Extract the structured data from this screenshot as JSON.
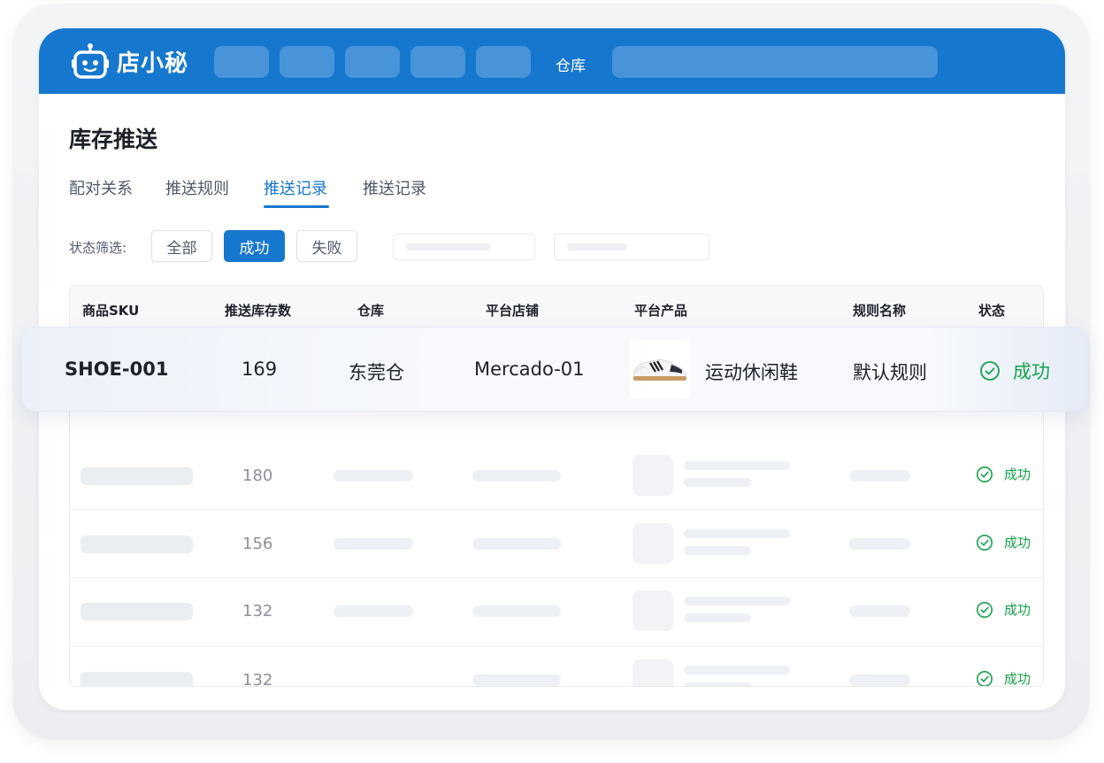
{
  "app": {
    "logo_text": "店小秘",
    "nav_label": "仓库"
  },
  "page": {
    "title": "库存推送",
    "tabs": [
      {
        "label": "配对关系",
        "active": false
      },
      {
        "label": "推送规则",
        "active": false
      },
      {
        "label": "推送记录",
        "active": true
      },
      {
        "label": "推送记录",
        "active": false
      }
    ]
  },
  "filters": {
    "label": "状态筛选:",
    "buttons": [
      {
        "label": "全部",
        "active": false
      },
      {
        "label": "成功",
        "active": true
      },
      {
        "label": "失败",
        "active": false
      }
    ]
  },
  "table": {
    "columns": [
      "商品SKU",
      "推送库存数",
      "仓库",
      "平台店铺",
      "平台产品",
      "规则名称",
      "状态"
    ],
    "highlight_row": {
      "sku": "SHOE-001",
      "stock": "169",
      "warehouse": "东莞仓",
      "shop": "Mercado-01",
      "product": "运动休闲鞋",
      "rule": "默认规则",
      "status": "成功"
    },
    "rows": [
      {
        "stock": "180",
        "status": "成功"
      },
      {
        "stock": "156",
        "status": "成功"
      },
      {
        "stock": "132",
        "status": "成功"
      },
      {
        "stock": "132",
        "status": "成功"
      }
    ]
  },
  "colors": {
    "brand": "#1677cf",
    "success": "#14a34a"
  }
}
